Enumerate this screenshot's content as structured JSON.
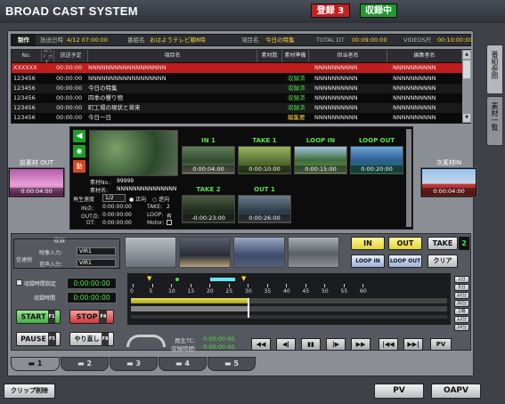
{
  "app": {
    "title": "BROAD CAST SYSTEM",
    "registered_label": "登録 3",
    "recording_label": "収録中"
  },
  "infobar": {
    "seisaku": "制作",
    "broadcast_label": "放送日時",
    "broadcast_value": "4/12 07:00:00",
    "program_label": "番組名",
    "program_value": "おはようテレビ朝8時",
    "item_label": "項目名",
    "item_value": "今日の特集",
    "total_label": "TOTAL DT",
    "total_value": "00:09:00:00",
    "video_label": "VIDEOS尺",
    "video_value": "00:10:00:00"
  },
  "table": {
    "columns": [
      "No.",
      "ｲﾍﾞﾝﾄﾞ ﾌﾗｸﾞ",
      "放送予定",
      "項目名",
      "素材数",
      "素材準備",
      "担当者名",
      "編集者名"
    ],
    "rows": [
      {
        "no": "XXXXXX",
        "time": "00:00:00",
        "name": "NNNNNNNNNNNNNNNNNN",
        "status": "",
        "person": "NNNNNNNNNN",
        "editor": "NNNNNNNNNN",
        "selected": true
      },
      {
        "no": "123456",
        "time": "00:00:00",
        "name": "NNNNNNNNNNNNNNNNNN",
        "status": "収録済",
        "person": "NNNNNNNNNN",
        "editor": "NNNNNNNNNN"
      },
      {
        "no": "123456",
        "time": "00:00:00",
        "name": "今日の特集",
        "status": "収録済",
        "person": "NNNNNNNNNN",
        "editor": "NNNNNNNNNN"
      },
      {
        "no": "123456",
        "time": "00:00:00",
        "name": "四季の響り物",
        "status": "収録済",
        "person": "NNNNNNNNNN",
        "editor": "NNNNNNNNNN"
      },
      {
        "no": "123456",
        "time": "00:00:00",
        "name": "町工場の現状と将来",
        "status": "収録済",
        "person": "NNNNNNNNNN",
        "editor": "NNNNNNNNNN"
      },
      {
        "no": "123456",
        "time": "00:00:00",
        "name": "今日一日",
        "status": "編集要",
        "person": "NNNNNNNNNN",
        "editor": "NNNNNNNNNN"
      }
    ]
  },
  "sidetabs": {
    "program_ref": "番組参照",
    "material_list": "素材一覧"
  },
  "monitor": {
    "prev_label": "前素材 OUT",
    "prev_tc": "0:00:04:00",
    "next_label": "次素材IN",
    "next_tc": "0:00:04:00",
    "in1_label": "IN 1",
    "in1_tc": "0:00:04:00",
    "take1_label": "TAKE 1",
    "take1_tc": "0:00:10:00",
    "loopin_label": "LOOP IN",
    "loopin_tc": "0:00:15:00",
    "loopout_label": "LOOP OUT",
    "loopout_tc": "0:00:20:00",
    "take2_label": "TAKE 2",
    "take2_tc": "-0:00:23:00",
    "out1_label": "OUT 1",
    "out1_tc": "0:00:26:00",
    "material_no_label": "素材No.:",
    "material_no_value": "99999",
    "material_name_label": "素材名:",
    "material_name_value": "NNNNNNNNNNNNNNN",
    "speed_label": "再生速度",
    "speed_value": "1/2",
    "forward_label": "正向",
    "reverse_label": "逆向",
    "in_point_label": "IN点:",
    "in_point_value": "0:00:00:00",
    "out_point_label": "OUT点:",
    "out_point_value": "0:00:00:00",
    "dt_label": "DT:",
    "dt_value": "0:00:00:00",
    "take_count_label": "TAKE:",
    "take_count_value": "2",
    "loop_label": "LOOP:",
    "loop_value": "有",
    "motor_label": "Motor:"
  },
  "recording": {
    "section_label": "収録",
    "source_label": "信達物",
    "video_input_label": "映像入力:",
    "video_input_value": "VIR1",
    "audio_input_label": "音声入力:",
    "audio_input_value": "VIR1",
    "time_spec_label": "収録時間指定",
    "time_spec_value": "0:00:00:00",
    "rec_time_label": "収録時間",
    "rec_time_value": "0:00:00:00",
    "start_label": "START",
    "start_key": "F1",
    "stop_label": "STOP",
    "stop_key": "F4",
    "pause_label": "PAUSE",
    "pause_key": "F5",
    "redo_label": "やり直し",
    "redo_key": "F8"
  },
  "edit_buttons": {
    "in": "IN",
    "out": "OUT",
    "take": "TAKE",
    "take_count": "2",
    "loop_in": "LOOP IN",
    "loop_out": "LOOP OUT",
    "clear": "クリア"
  },
  "timeline": {
    "ticks": [
      "0",
      "5",
      "10",
      "15",
      "20",
      "25",
      "30",
      "35",
      "40",
      "45",
      "50",
      "55",
      "60"
    ],
    "zoom_buttons": [
      "1分",
      "5分",
      "10分",
      "30分",
      "1時",
      "12分",
      "24分"
    ],
    "played_fraction": 0.37,
    "loop_start_fraction": 0.25,
    "loop_end_fraction": 0.33
  },
  "transport": {
    "playback_tc_label": "再生TC:",
    "playback_tc_value": "0:00:00:00",
    "rec_tc_label": "収録時間:",
    "rec_tc_value": "0:00:00:00",
    "pv": "PV",
    "buttons": [
      "◀▶|◀",
      "◀|▶",
      "▮▮",
      "▶|",
      "▶▶|",
      "|◀◀",
      "▶▶|"
    ]
  },
  "tabs": [
    "1",
    "2",
    "3",
    "4",
    "5"
  ],
  "footer": {
    "clip_delete": "クリップ削除",
    "pv": "PV",
    "oapv": "OAPV"
  },
  "colors": {
    "selected_row": "#c21d1d",
    "status_green": "#4de04a",
    "status_yellow": "#ffd23a",
    "start_green": "#3fae3f",
    "stop_red": "#d23535"
  }
}
